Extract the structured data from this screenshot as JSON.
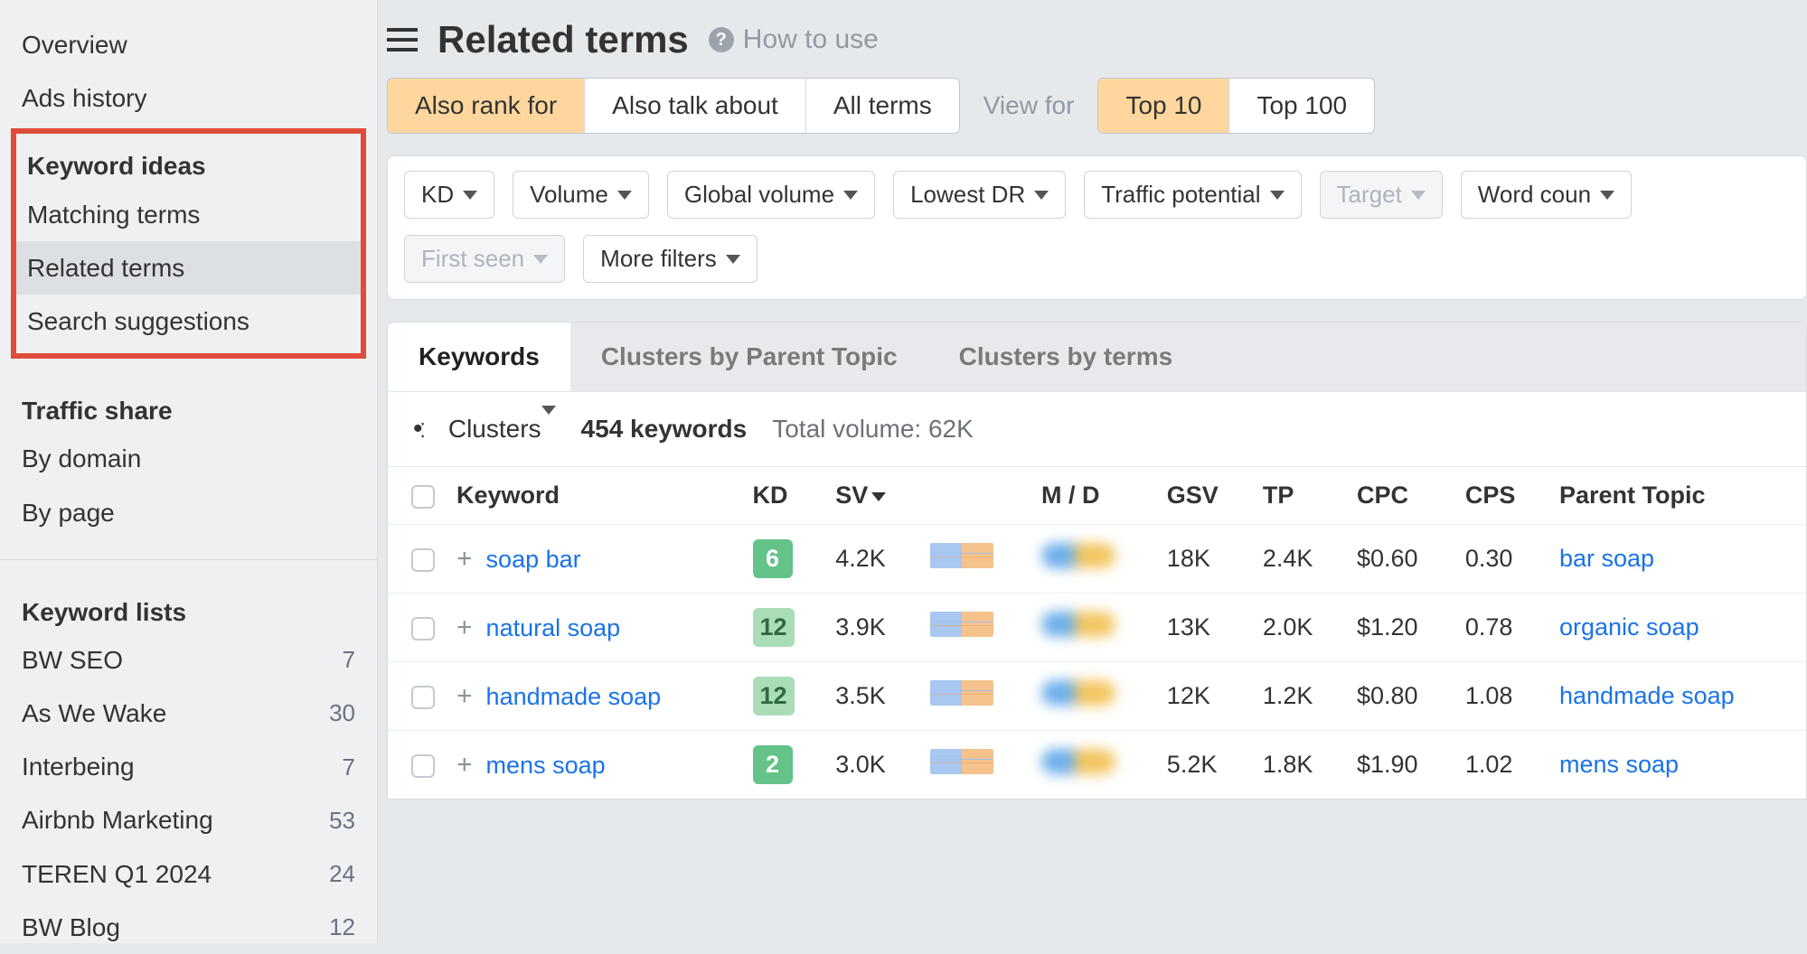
{
  "sidebar": {
    "top": [
      "Overview",
      "Ads history"
    ],
    "keyword_ideas": {
      "heading": "Keyword ideas",
      "items": [
        "Matching terms",
        "Related terms",
        "Search suggestions"
      ],
      "active_index": 1
    },
    "traffic_share": {
      "heading": "Traffic share",
      "items": [
        "By domain",
        "By page"
      ]
    },
    "keyword_lists": {
      "heading": "Keyword lists",
      "items": [
        {
          "name": "BW SEO",
          "count": 7
        },
        {
          "name": "As We Wake",
          "count": 30
        },
        {
          "name": "Interbeing",
          "count": 7
        },
        {
          "name": "Airbnb Marketing",
          "count": 53
        },
        {
          "name": "TEREN Q1 2024",
          "count": 24
        },
        {
          "name": "BW Blog",
          "count": 12
        }
      ]
    }
  },
  "header": {
    "title": "Related terms",
    "how_to_use": "How to use"
  },
  "mode_tabs": {
    "group1": [
      "Also rank for",
      "Also talk about",
      "All terms"
    ],
    "group1_selected": 0,
    "view_for": "View for",
    "group2": [
      "Top 10",
      "Top 100"
    ],
    "group2_selected": 0
  },
  "filters": {
    "row1": [
      "KD",
      "Volume",
      "Global volume",
      "Lowest DR",
      "Traffic potential",
      "Target",
      "Word coun"
    ],
    "row1_disabled": [
      5
    ],
    "row2": [
      "First seen",
      "More filters"
    ],
    "row2_disabled": [
      0
    ]
  },
  "result_tabs": [
    "Keywords",
    "Clusters by Parent Topic",
    "Clusters by terms"
  ],
  "result_tab_selected": 0,
  "stats": {
    "clusters_label": "Clusters",
    "keywords_count": "454 keywords",
    "total_volume": "Total volume: 62K"
  },
  "table": {
    "headers": {
      "keyword": "Keyword",
      "kd": "KD",
      "sv": "SV",
      "md": "M / D",
      "gsv": "GSV",
      "tp": "TP",
      "cpc": "CPC",
      "cps": "CPS",
      "parent": "Parent Topic"
    },
    "rows": [
      {
        "keyword": "soap bar",
        "kd": 6,
        "kd_class": "",
        "sv": "4.2K",
        "gsv": "18K",
        "tp": "2.4K",
        "cpc": "$0.60",
        "cps": "0.30",
        "parent": "bar soap"
      },
      {
        "keyword": "natural soap",
        "kd": 12,
        "kd_class": "light",
        "sv": "3.9K",
        "gsv": "13K",
        "tp": "2.0K",
        "cpc": "$1.20",
        "cps": "0.78",
        "parent": "organic soap"
      },
      {
        "keyword": "handmade soap",
        "kd": 12,
        "kd_class": "light",
        "sv": "3.5K",
        "gsv": "12K",
        "tp": "1.2K",
        "cpc": "$0.80",
        "cps": "1.08",
        "parent": "handmade soap"
      },
      {
        "keyword": "mens soap",
        "kd": 2,
        "kd_class": "",
        "sv": "3.0K",
        "gsv": "5.2K",
        "tp": "1.8K",
        "cpc": "$1.90",
        "cps": "1.02",
        "parent": "mens soap"
      }
    ]
  }
}
